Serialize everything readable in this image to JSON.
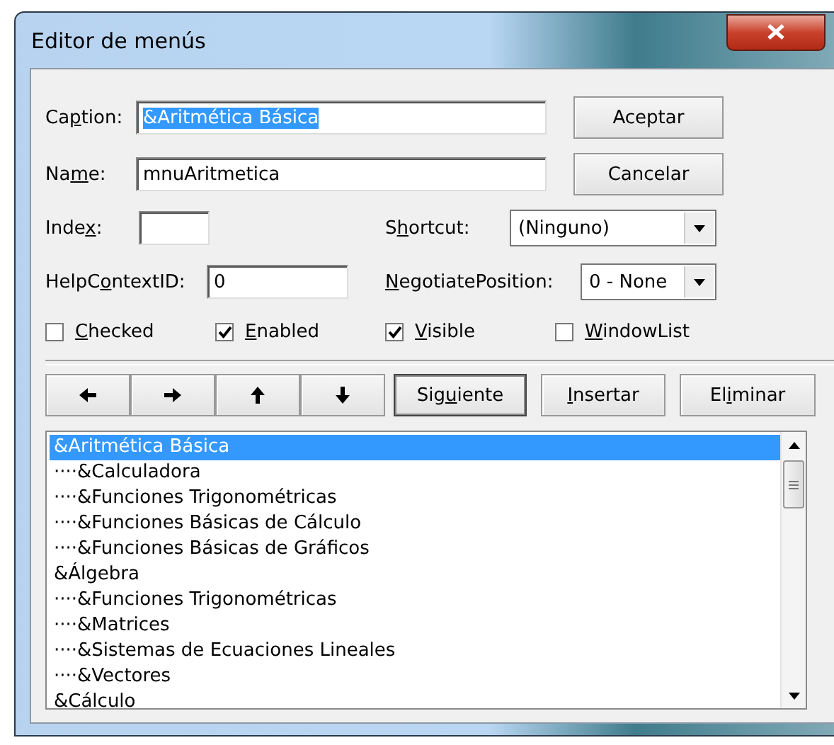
{
  "window": {
    "title": "Editor de menús"
  },
  "fields": [
    {
      "label": {
        "before": "Ca",
        "key": "p",
        "after": "tion:"
      },
      "value": "&Aritmética Básica",
      "selected": true
    },
    {
      "label": {
        "before": "Na",
        "key": "m",
        "after": "e:"
      },
      "value": "mnuAritmetica",
      "selected": false
    }
  ],
  "side_buttons": [
    {
      "label": "Aceptar"
    },
    {
      "label": "Cancelar"
    }
  ],
  "index": {
    "label": {
      "before": "Inde",
      "key": "x",
      "after": ":"
    }
  },
  "shortcut": {
    "label": {
      "before": "S",
      "key": "h",
      "after": "ortcut:"
    },
    "value": "(Ninguno)"
  },
  "help_context": {
    "label": {
      "before": "HelpC",
      "key": "o",
      "after": "ntextID:"
    },
    "value": "0"
  },
  "negotiate": {
    "label": {
      "key": "N",
      "after": "egotiatePosition:"
    },
    "value": "0 - None"
  },
  "checkboxes": [
    {
      "label": {
        "key": "C",
        "after": "hecked"
      },
      "checked": false
    },
    {
      "label": {
        "key": "E",
        "after": "nabled"
      },
      "checked": true
    },
    {
      "label": {
        "key": "V",
        "after": "isible"
      },
      "checked": true
    },
    {
      "label": {
        "key": "W",
        "after": "indowList"
      },
      "checked": false
    }
  ],
  "arrow_buttons": [
    {
      "kind": "left"
    },
    {
      "kind": "right"
    },
    {
      "kind": "up"
    },
    {
      "kind": "down"
    }
  ],
  "action_buttons": [
    {
      "label": {
        "before": "Sig",
        "key": "u",
        "after": "iente"
      },
      "default": true
    },
    {
      "label": {
        "key": "I",
        "after": "nsertar"
      },
      "default": false
    },
    {
      "label": {
        "before": "El",
        "key": "i",
        "after": "minar"
      },
      "default": false
    }
  ],
  "menu_list": [
    {
      "text": "&Aritmética Básica",
      "selected": true
    },
    {
      "text": "····&Calculadora",
      "selected": false
    },
    {
      "text": "····&Funciones Trigonométricas",
      "selected": false
    },
    {
      "text": "····&Funciones Básicas de Cálculo",
      "selected": false
    },
    {
      "text": "····&Funciones Básicas de Gráficos",
      "selected": false
    },
    {
      "text": "&Álgebra",
      "selected": false
    },
    {
      "text": "····&Funciones Trigonométricas",
      "selected": false
    },
    {
      "text": "····&Matrices",
      "selected": false
    },
    {
      "text": "····&Sistemas de Ecuaciones Lineales",
      "selected": false
    },
    {
      "text": "····&Vectores",
      "selected": false
    },
    {
      "text": "&Cálculo",
      "selected": false
    }
  ]
}
